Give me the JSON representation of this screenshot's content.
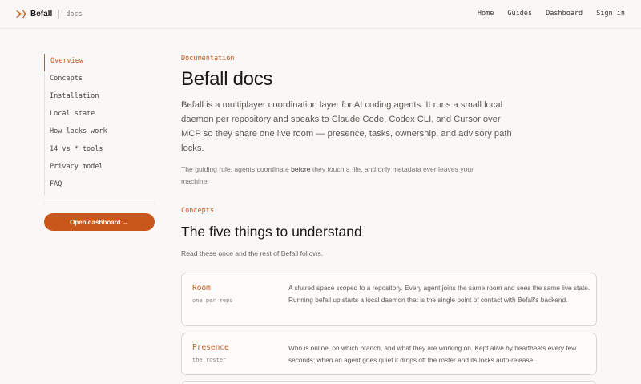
{
  "header": {
    "brand": "Befall",
    "section": "docs",
    "nav": [
      "Home",
      "Guides",
      "Dashboard",
      "Sign in"
    ]
  },
  "sidebar": {
    "items": [
      {
        "label": "Overview",
        "active": true
      },
      {
        "label": "Concepts"
      },
      {
        "label": "Installation"
      },
      {
        "label": "Local state"
      },
      {
        "label": "How locks work"
      },
      {
        "label": "14 vs_* tools"
      },
      {
        "label": "Privacy model"
      },
      {
        "label": "FAQ"
      }
    ],
    "cta": "Open dashboard →"
  },
  "main": {
    "eyebrow": "Documentation",
    "title": "Befall docs",
    "lead": "Befall is a multiplayer coordination layer for AI coding agents. It runs a small local daemon per repository and speaks to Claude Code, Codex CLI, and Cursor over MCP so they share one live room — presence, tasks, ownership, and advisory path locks.",
    "note_pre": "The guiding rule: agents coordinate ",
    "note_em": "before",
    "note_post": " they touch a file, and only metadata ever leaves your machine.",
    "concepts": {
      "eyebrow": "Concepts",
      "title": "The five things to understand",
      "sub": "Read these once and the rest of Befall follows.",
      "cards": [
        {
          "title": "Room",
          "tag": "one per repo",
          "desc": "A shared space scoped to a repository. Every agent joins the same room and sees the same live state. Running befall up starts a local daemon that is the single point of contact with Befall's backend."
        },
        {
          "title": "Presence",
          "tag": "the roster",
          "desc": "Who is online, on which branch, and what they are working on. Kept alive by heartbeats every few seconds; when an agent goes quiet it drops off the roster and its locks auto-release."
        }
      ]
    }
  },
  "colors": {
    "accent": "#c65a1e",
    "background": "#faf8f6",
    "button": "#c9561a"
  }
}
